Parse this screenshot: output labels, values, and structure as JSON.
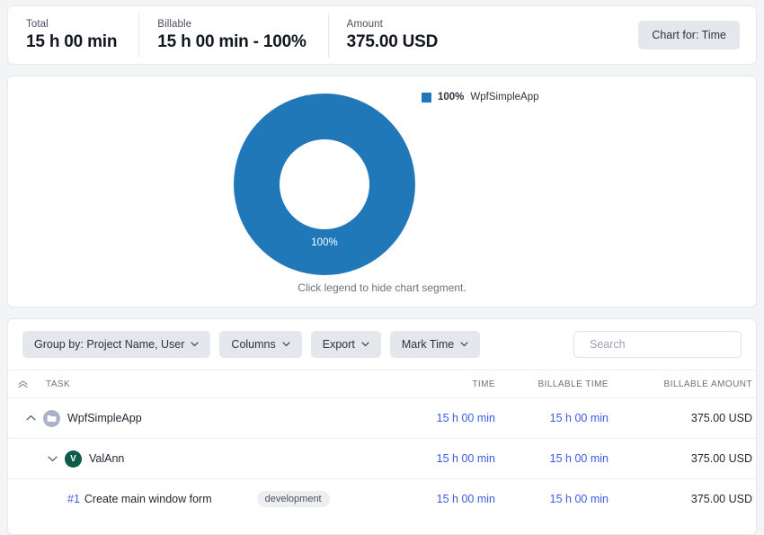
{
  "summary": {
    "stats": [
      {
        "label": "Total",
        "value": "15 h 00 min"
      },
      {
        "label": "Billable",
        "value": "15 h 00 min - 100%"
      },
      {
        "label": "Amount",
        "value": "375.00 USD"
      }
    ],
    "chart_for_button": "Chart for: Time"
  },
  "chart": {
    "center_label": "100%",
    "hint": "Click legend to hide chart segment.",
    "legend": [
      {
        "percent": "100%",
        "name": "WpfSimpleApp",
        "color": "#2178b8"
      }
    ]
  },
  "chart_data": {
    "type": "pie",
    "title": "",
    "subtype": "donut",
    "categories": [
      "WpfSimpleApp"
    ],
    "values": [
      100
    ],
    "value_labels": [
      "100%"
    ],
    "colors": [
      "#2178b8"
    ],
    "legend_position": "right",
    "legend_entries": [
      "100%  WpfSimpleApp"
    ],
    "annotations": [
      "Click legend to hide chart segment."
    ],
    "measure": "Time",
    "total": "15 h 00 min"
  },
  "toolbar": {
    "group_by": "Group by: Project Name, User",
    "columns": "Columns",
    "export": "Export",
    "mark_time": "Mark Time",
    "search_placeholder": "Search",
    "search_value": ""
  },
  "table": {
    "headers": {
      "task": "TASK",
      "time": "TIME",
      "billable_time": "BILLABLE TIME",
      "billable_amount": "BILLABLE AMOUNT"
    },
    "rows": [
      {
        "type": "project",
        "name": "WpfSimpleApp",
        "time": "15 h 00 min",
        "billable_time": "15 h 00 min",
        "billable_amount": "375.00 USD"
      },
      {
        "type": "user",
        "name": "ValAnn",
        "avatar_initial": "V",
        "time": "15 h 00 min",
        "billable_time": "15 h 00 min",
        "billable_amount": "375.00 USD"
      },
      {
        "type": "task",
        "task_id": "#1",
        "name": "Create main window form",
        "tag": "development",
        "time": "15 h 00 min",
        "billable_time": "15 h 00 min",
        "billable_amount": "375.00 USD"
      }
    ]
  },
  "colors": {
    "accent_blue": "#2178b8",
    "link_blue": "#3b5ce6",
    "avatar_green": "#0d5c4a",
    "button_gray": "#e4e7eb"
  }
}
